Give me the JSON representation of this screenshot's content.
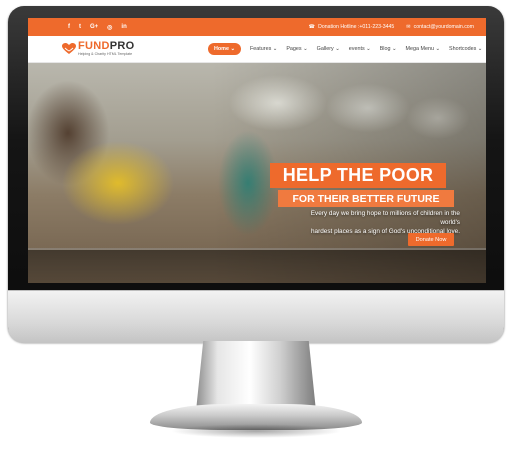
{
  "topbar": {
    "social_icons": [
      {
        "name": "facebook-icon",
        "glyph": "f"
      },
      {
        "name": "twitter-icon",
        "glyph": "t"
      },
      {
        "name": "google-plus-icon",
        "glyph": "G+"
      },
      {
        "name": "instagram-icon",
        "glyph": "◎"
      },
      {
        "name": "linkedin-icon",
        "glyph": "in"
      }
    ],
    "hotline": "Donation Hotline :+011-223-3445",
    "email": "contact@yourdomain.com"
  },
  "logo": {
    "brand_main": "FUND",
    "brand_accent": "PRO",
    "tagline": "Helping & Charity HTML Template"
  },
  "nav": {
    "items": [
      {
        "label": "Home",
        "active": true
      },
      {
        "label": "Features",
        "active": false
      },
      {
        "label": "Pages",
        "active": false
      },
      {
        "label": "Gallery",
        "active": false
      },
      {
        "label": "events",
        "active": false
      },
      {
        "label": "Blog",
        "active": false
      },
      {
        "label": "Mega Menu",
        "active": false
      },
      {
        "label": "Shortcodes",
        "active": false
      }
    ],
    "dropdown_glyph": "⌄"
  },
  "hero": {
    "title": "HELP THE POOR",
    "subtitle": "FOR THEIR BETTER FUTURE",
    "body_line1": "Every day we bring hope to millions of children in the world's",
    "body_line2": "hardest places as a sign of God's unconditional love.",
    "cta": "Donate Now"
  },
  "colors": {
    "accent": "#ee6a2c",
    "accent_light": "#f07a3f",
    "bezel": "#111111"
  }
}
